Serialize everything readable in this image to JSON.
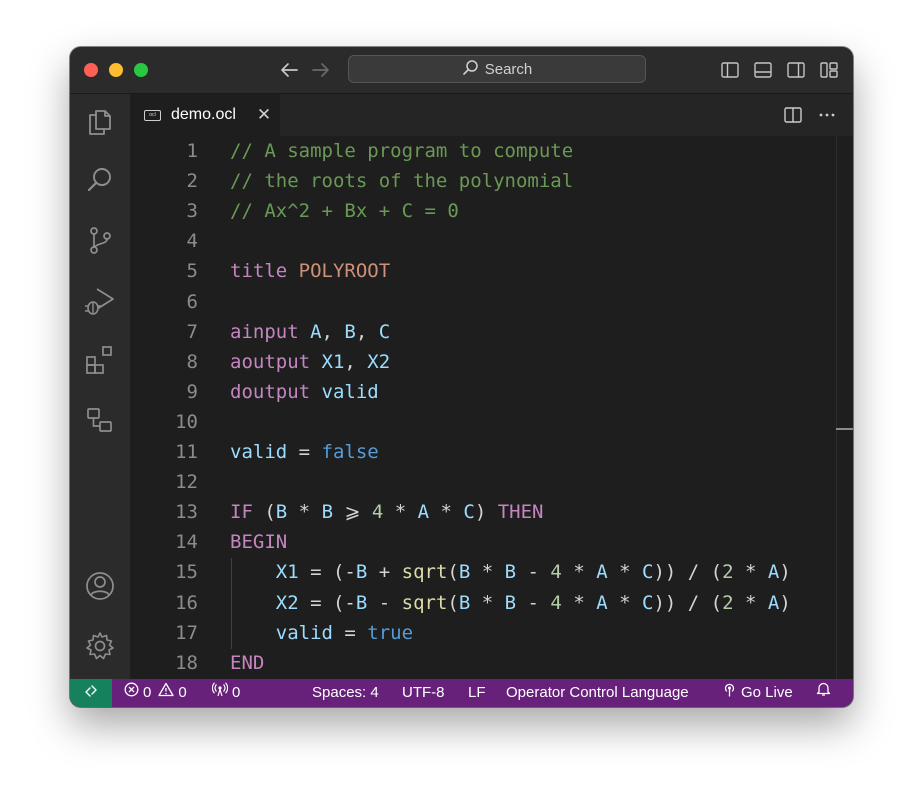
{
  "titlebar": {
    "search_label": "Search"
  },
  "tab": {
    "filename": "demo.ocl",
    "file_icon_text": "ocl"
  },
  "editor": {
    "lines": [
      {
        "n": "1",
        "tokens": [
          {
            "t": "// A sample program to compute",
            "c": "comment"
          }
        ]
      },
      {
        "n": "2",
        "tokens": [
          {
            "t": "// the roots of the polynomial",
            "c": "comment"
          }
        ]
      },
      {
        "n": "3",
        "tokens": [
          {
            "t": "// Ax^2 + Bx + C = 0",
            "c": "comment"
          }
        ]
      },
      {
        "n": "4",
        "tokens": []
      },
      {
        "n": "5",
        "tokens": [
          {
            "t": "title ",
            "c": "kw"
          },
          {
            "t": "POLYROOT",
            "c": "str"
          }
        ]
      },
      {
        "n": "6",
        "tokens": []
      },
      {
        "n": "7",
        "tokens": [
          {
            "t": "ainput ",
            "c": "kw"
          },
          {
            "t": "A",
            "c": "var"
          },
          {
            "t": ", ",
            "c": "op"
          },
          {
            "t": "B",
            "c": "var"
          },
          {
            "t": ", ",
            "c": "op"
          },
          {
            "t": "C",
            "c": "var"
          }
        ]
      },
      {
        "n": "8",
        "tokens": [
          {
            "t": "aoutput ",
            "c": "kw"
          },
          {
            "t": "X1",
            "c": "var"
          },
          {
            "t": ", ",
            "c": "op"
          },
          {
            "t": "X2",
            "c": "var"
          }
        ]
      },
      {
        "n": "9",
        "tokens": [
          {
            "t": "doutput ",
            "c": "kw"
          },
          {
            "t": "valid",
            "c": "var"
          }
        ]
      },
      {
        "n": "10",
        "tokens": []
      },
      {
        "n": "11",
        "tokens": [
          {
            "t": "valid",
            "c": "var"
          },
          {
            "t": " = ",
            "c": "op"
          },
          {
            "t": "false",
            "c": "const"
          }
        ]
      },
      {
        "n": "12",
        "tokens": []
      },
      {
        "n": "13",
        "tokens": [
          {
            "t": "IF ",
            "c": "kw"
          },
          {
            "t": "(",
            "c": "op"
          },
          {
            "t": "B",
            "c": "var"
          },
          {
            "t": " * ",
            "c": "op"
          },
          {
            "t": "B",
            "c": "var"
          },
          {
            "t": " ⩾ ",
            "c": "op"
          },
          {
            "t": "4",
            "c": "num"
          },
          {
            "t": " * ",
            "c": "op"
          },
          {
            "t": "A",
            "c": "var"
          },
          {
            "t": " * ",
            "c": "op"
          },
          {
            "t": "C",
            "c": "var"
          },
          {
            "t": ") ",
            "c": "op"
          },
          {
            "t": "THEN",
            "c": "kw"
          }
        ]
      },
      {
        "n": "14",
        "tokens": [
          {
            "t": "BEGIN",
            "c": "kw"
          }
        ]
      },
      {
        "n": "15",
        "tokens": [
          {
            "t": "    ",
            "c": "op"
          },
          {
            "t": "X1",
            "c": "var"
          },
          {
            "t": " = (-",
            "c": "op"
          },
          {
            "t": "B",
            "c": "var"
          },
          {
            "t": " + ",
            "c": "op"
          },
          {
            "t": "sqrt",
            "c": "fn"
          },
          {
            "t": "(",
            "c": "op"
          },
          {
            "t": "B",
            "c": "var"
          },
          {
            "t": " * ",
            "c": "op"
          },
          {
            "t": "B",
            "c": "var"
          },
          {
            "t": " - ",
            "c": "op"
          },
          {
            "t": "4",
            "c": "num"
          },
          {
            "t": " * ",
            "c": "op"
          },
          {
            "t": "A",
            "c": "var"
          },
          {
            "t": " * ",
            "c": "op"
          },
          {
            "t": "C",
            "c": "var"
          },
          {
            "t": ")) / (",
            "c": "op"
          },
          {
            "t": "2",
            "c": "num"
          },
          {
            "t": " * ",
            "c": "op"
          },
          {
            "t": "A",
            "c": "var"
          },
          {
            "t": ")",
            "c": "op"
          }
        ]
      },
      {
        "n": "16",
        "tokens": [
          {
            "t": "    ",
            "c": "op"
          },
          {
            "t": "X2",
            "c": "var"
          },
          {
            "t": " = (-",
            "c": "op"
          },
          {
            "t": "B",
            "c": "var"
          },
          {
            "t": " - ",
            "c": "op"
          },
          {
            "t": "sqrt",
            "c": "fn"
          },
          {
            "t": "(",
            "c": "op"
          },
          {
            "t": "B",
            "c": "var"
          },
          {
            "t": " * ",
            "c": "op"
          },
          {
            "t": "B",
            "c": "var"
          },
          {
            "t": " - ",
            "c": "op"
          },
          {
            "t": "4",
            "c": "num"
          },
          {
            "t": " * ",
            "c": "op"
          },
          {
            "t": "A",
            "c": "var"
          },
          {
            "t": " * ",
            "c": "op"
          },
          {
            "t": "C",
            "c": "var"
          },
          {
            "t": ")) / (",
            "c": "op"
          },
          {
            "t": "2",
            "c": "num"
          },
          {
            "t": " * ",
            "c": "op"
          },
          {
            "t": "A",
            "c": "var"
          },
          {
            "t": ")",
            "c": "op"
          }
        ]
      },
      {
        "n": "17",
        "tokens": [
          {
            "t": "    ",
            "c": "op"
          },
          {
            "t": "valid",
            "c": "var"
          },
          {
            "t": " = ",
            "c": "op"
          },
          {
            "t": "true",
            "c": "const"
          }
        ]
      },
      {
        "n": "18",
        "tokens": [
          {
            "t": "END",
            "c": "kw"
          }
        ]
      }
    ]
  },
  "statusbar": {
    "errors": "0",
    "warnings": "0",
    "ports": "0",
    "spaces": "Spaces: 4",
    "encoding": "UTF-8",
    "eol": "LF",
    "language": "Operator Control Language",
    "go_live": "Go Live"
  },
  "icons": [
    "back-arrow-icon",
    "forward-arrow-icon",
    "search-icon",
    "explorer-icon",
    "search-icon",
    "source-control-icon",
    "run-debug-icon",
    "extensions-icon",
    "remote-explorer-icon",
    "account-icon",
    "gear-icon",
    "split-editor-icon",
    "more-icon",
    "close-icon",
    "remote-icon",
    "error-icon",
    "warning-icon",
    "broadcast-icon",
    "bell-icon"
  ],
  "colors": {
    "statusbar": "#68217a",
    "remote": "#16825d",
    "comment": "#6a9955",
    "keyword": "#c586c0",
    "string": "#ce9178",
    "variable": "#9cdcfe",
    "constant": "#569cd6",
    "number": "#b5cea8",
    "function": "#dcdcaa"
  }
}
